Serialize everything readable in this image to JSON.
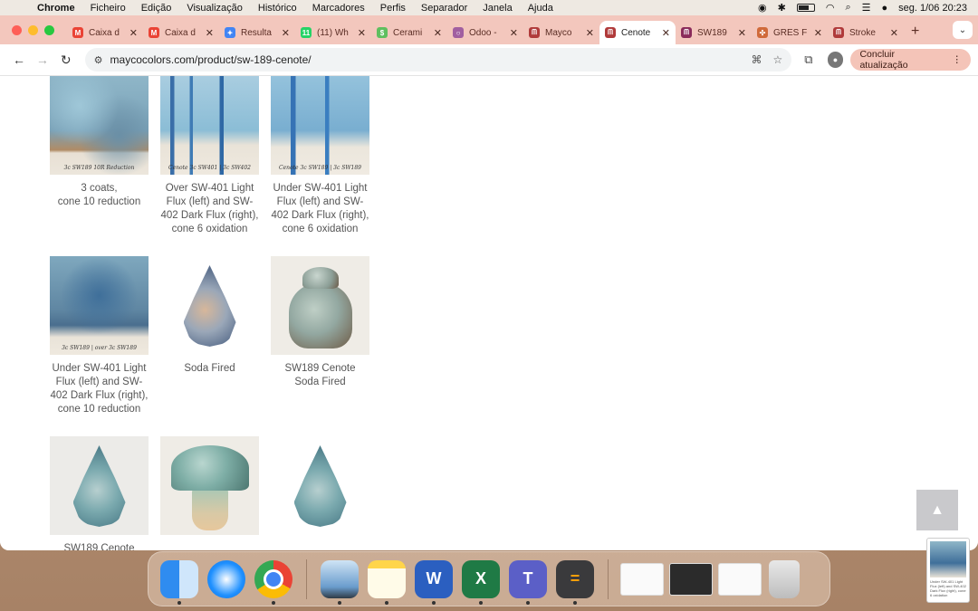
{
  "menubar": {
    "app": "Chrome",
    "items": [
      "Ficheiro",
      "Edição",
      "Visualização",
      "Histórico",
      "Marcadores",
      "Perfis",
      "Separador",
      "Janela",
      "Ajuda"
    ],
    "clock": "seg. 1/06  20:23"
  },
  "tabs": [
    {
      "label": "Caixa d",
      "favicon": "M",
      "color": "#ea4335"
    },
    {
      "label": "Caixa d",
      "favicon": "M",
      "color": "#ea4335"
    },
    {
      "label": "Resulta",
      "favicon": "✦",
      "color": "#4285f4"
    },
    {
      "label": "(11) Wh",
      "favicon": "11",
      "color": "#25d366"
    },
    {
      "label": "Cerami",
      "favicon": "$",
      "color": "#5fbf5f"
    },
    {
      "label": "Odoo -",
      "favicon": "○",
      "color": "#a15fa0"
    },
    {
      "label": "Mayco",
      "favicon": "ᗰ",
      "color": "#b03a3a"
    },
    {
      "label": "Cenote",
      "favicon": "ᗰ",
      "color": "#b03a3a",
      "active": true
    },
    {
      "label": "SW189",
      "favicon": "ᗰ",
      "color": "#8a2a5a"
    },
    {
      "label": "GRES F",
      "favicon": "✣",
      "color": "#d06a3a"
    },
    {
      "label": "Stroke",
      "favicon": "ᗰ",
      "color": "#b03a3a"
    }
  ],
  "toolbar": {
    "url": "maycocolors.com/product/sw-189-cenote/",
    "update_label": "Concluir atualização"
  },
  "gallery": [
    {
      "caption": "3 coats,\ncone 10 reduction",
      "tile": "tile-blue",
      "label": "3c SW189  10R Reduction"
    },
    {
      "caption": "Over SW-401 Light Flux (left) and SW-402 Dark Flux (right), cone 6 oxidation",
      "tile": "tile-drip",
      "label": "Cenote  3c SW401 | 3c SW402"
    },
    {
      "caption": "Under SW-401 Light Flux (left) and SW-402 Dark Flux (right), cone 6 oxidation",
      "tile": "tile-drip2",
      "label": "Cenote  3c SW189 | 3c SW189"
    },
    {
      "caption": "Under SW-401 Light Flux (left) and SW-402 Dark Flux (right), cone 10 reduction",
      "tile": "tile-dark",
      "label": "3c SW189 | over 3c SW189"
    },
    {
      "caption": "Soda Fired",
      "tile": "drop"
    },
    {
      "caption": "SW189 Cenote\nSoda Fired",
      "tile": "jar"
    },
    {
      "caption": "SW189 Cenote",
      "tile": "tealdrop"
    },
    {
      "caption": "",
      "tile": "mushroom"
    },
    {
      "caption": "",
      "tile": "tealdrop2"
    }
  ],
  "back_to_top": "▲",
  "dock": [
    "Finder",
    "Safari",
    "Chrome",
    "Preview",
    "Notes",
    "Word",
    "Excel",
    "Teams",
    "Calculator"
  ]
}
